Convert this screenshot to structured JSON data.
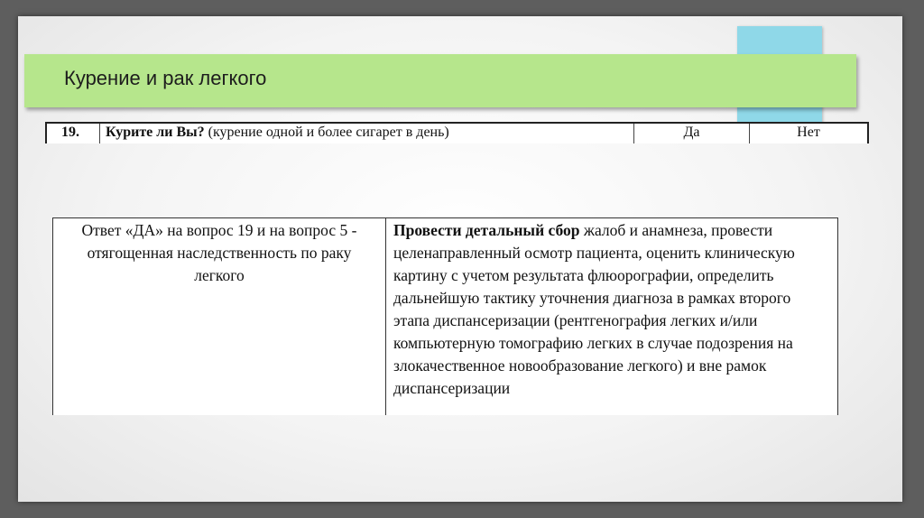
{
  "slide": {
    "title": "Курение и рак легкого"
  },
  "question_row": {
    "number": "19.",
    "question_bold": "Курите ли Вы?",
    "question_note": " (курение одной и более сигарет в день)",
    "option_yes": "Да",
    "option_no": "Нет"
  },
  "result_table": {
    "condition": "Ответ «ДА» на вопрос 19 и на вопрос 5 - отягощенная наследственность по раку легкого",
    "action_bold": "Провести детальный сбор",
    "action_text": " жалоб и анамнеза, провести целенаправленный осмотр пациента, оценить клиническую картину с учетом результата флюорографии, определить дальнейшую тактику уточнения диагноза в рамках второго этапа диспансеризации (рентгенография легких и/или компьютерную томографию легких в случае подозрения на злокачественное новообразование легкого) и вне рамок диспансеризации"
  },
  "colors": {
    "title_bar": "#b6e68c",
    "accent": "#8fd8e8",
    "frame": "#5e5e5e"
  }
}
